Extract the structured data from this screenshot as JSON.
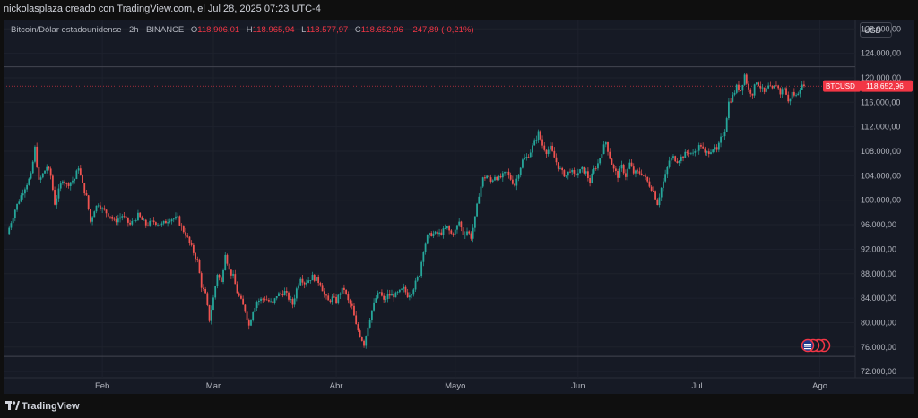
{
  "header": {
    "attribution": "nickolasplaza creado con TradingView.com, el Jul 28, 2025 07:23 UTC-4"
  },
  "legend": {
    "symbol": "Bitcoin/Dólar estadounidense · 2h · BINANCE",
    "open_label": "O",
    "open": "118.906,01",
    "high_label": "H",
    "high": "118.965,94",
    "low_label": "L",
    "low": "118.577,97",
    "close_label": "C",
    "close": "118.652,96",
    "change": "-247,89 (-0,21%)"
  },
  "currency_button": "USD",
  "price_tag": {
    "symbol": "BTCUSD",
    "price": "118.652,96"
  },
  "footer": {
    "brand": "TradingView"
  },
  "colors": {
    "up": "#26a69a",
    "down": "#ef5350",
    "background": "#161a25",
    "price_tag": "#f23645"
  },
  "chart_data": {
    "type": "candlestick",
    "title": "Bitcoin/Dólar estadounidense · 2h · BINANCE",
    "y_axis_position": "right",
    "ylim": [
      71000,
      129500
    ],
    "y_ticks": [
      {
        "value": 72000,
        "label": "72.000,00"
      },
      {
        "value": 76000,
        "label": "76.000,00"
      },
      {
        "value": 80000,
        "label": "80.000,00"
      },
      {
        "value": 84000,
        "label": "84.000,00"
      },
      {
        "value": 88000,
        "label": "88.000,00"
      },
      {
        "value": 92000,
        "label": "92.000,00"
      },
      {
        "value": 96000,
        "label": "96.000,00"
      },
      {
        "value": 100000,
        "label": "100.000,00"
      },
      {
        "value": 104000,
        "label": "104.000,00"
      },
      {
        "value": 108000,
        "label": "108.000,00"
      },
      {
        "value": 112000,
        "label": "112.000,00"
      },
      {
        "value": 116000,
        "label": "116.000,00"
      },
      {
        "value": 120000,
        "label": "120.000,00"
      },
      {
        "value": 124000,
        "label": "124.000,00"
      },
      {
        "value": 128000,
        "label": "128.000,00"
      }
    ],
    "x_ticks": [
      {
        "day": 31,
        "label": "Feb"
      },
      {
        "day": 59,
        "label": "Mar"
      },
      {
        "day": 90,
        "label": "Abr"
      },
      {
        "day": 120,
        "label": "Mayo"
      },
      {
        "day": 151,
        "label": "Jun"
      },
      {
        "day": 181,
        "label": "Jul"
      },
      {
        "day": 212,
        "label": "Ago"
      }
    ],
    "x_unit": "day of year 2025",
    "xlim": [
      7,
      220
    ],
    "horizontal_lines": [
      121800,
      74500
    ],
    "last_price": 118652.96,
    "close_path": [
      [
        7,
        94500
      ],
      [
        9,
        98500
      ],
      [
        11,
        101500
      ],
      [
        13,
        104000
      ],
      [
        14,
        108500
      ],
      [
        15,
        103000
      ],
      [
        17,
        105500
      ],
      [
        18,
        104000
      ],
      [
        19,
        99500
      ],
      [
        20,
        101500
      ],
      [
        21,
        103500
      ],
      [
        22,
        102500
      ],
      [
        24,
        103500
      ],
      [
        25,
        105500
      ],
      [
        26,
        102500
      ],
      [
        27,
        100500
      ],
      [
        28,
        96500
      ],
      [
        29,
        98500
      ],
      [
        30,
        99500
      ],
      [
        31,
        98500
      ],
      [
        33,
        97500
      ],
      [
        34,
        96500
      ],
      [
        36,
        97500
      ],
      [
        38,
        96000
      ],
      [
        40,
        97500
      ],
      [
        42,
        96000
      ],
      [
        44,
        96500
      ],
      [
        46,
        96000
      ],
      [
        48,
        97000
      ],
      [
        50,
        97000
      ],
      [
        51,
        95500
      ],
      [
        52,
        94500
      ],
      [
        53,
        93000
      ],
      [
        55,
        90000
      ],
      [
        56,
        86000
      ],
      [
        57,
        84500
      ],
      [
        58,
        80500
      ],
      [
        59,
        84000
      ],
      [
        60,
        88000
      ],
      [
        61,
        86500
      ],
      [
        62,
        91500
      ],
      [
        63,
        88500
      ],
      [
        64,
        87500
      ],
      [
        65,
        85000
      ],
      [
        66,
        83500
      ],
      [
        67,
        82000
      ],
      [
        68,
        79500
      ],
      [
        69,
        82000
      ],
      [
        70,
        83500
      ],
      [
        72,
        84000
      ],
      [
        74,
        83000
      ],
      [
        75,
        84500
      ],
      [
        77,
        85000
      ],
      [
        78,
        84000
      ],
      [
        79,
        83000
      ],
      [
        80,
        85500
      ],
      [
        81,
        87500
      ],
      [
        82,
        86500
      ],
      [
        84,
        87500
      ],
      [
        86,
        86500
      ],
      [
        87,
        84500
      ],
      [
        88,
        83500
      ],
      [
        89,
        84000
      ],
      [
        90,
        83500
      ],
      [
        91,
        85000
      ],
      [
        92,
        85500
      ],
      [
        93,
        83500
      ],
      [
        94,
        82500
      ],
      [
        95,
        79500
      ],
      [
        96,
        78000
      ],
      [
        97,
        76500
      ],
      [
        98,
        79500
      ],
      [
        99,
        82000
      ],
      [
        100,
        84000
      ],
      [
        101,
        85000
      ],
      [
        102,
        83500
      ],
      [
        103,
        84500
      ],
      [
        105,
        84500
      ],
      [
        106,
        85000
      ],
      [
        107,
        85500
      ],
      [
        108,
        84500
      ],
      [
        109,
        85000
      ],
      [
        110,
        86500
      ],
      [
        111,
        88000
      ],
      [
        112,
        92000
      ],
      [
        113,
        94000
      ],
      [
        114,
        94500
      ],
      [
        116,
        94500
      ],
      [
        117,
        95000
      ],
      [
        118,
        95500
      ],
      [
        119,
        94500
      ],
      [
        120,
        95000
      ],
      [
        121,
        96500
      ],
      [
        122,
        94500
      ],
      [
        123,
        95000
      ],
      [
        124,
        94000
      ],
      [
        125,
        97000
      ],
      [
        126,
        101000
      ],
      [
        127,
        103500
      ],
      [
        128,
        104000
      ],
      [
        129,
        103000
      ],
      [
        130,
        104000
      ],
      [
        131,
        103500
      ],
      [
        133,
        104500
      ],
      [
        134,
        103500
      ],
      [
        135,
        102500
      ],
      [
        136,
        104500
      ],
      [
        137,
        106500
      ],
      [
        138,
        107000
      ],
      [
        139,
        108000
      ],
      [
        140,
        109500
      ],
      [
        141,
        111000
      ],
      [
        142,
        109000
      ],
      [
        143,
        108000
      ],
      [
        144,
        108500
      ],
      [
        145,
        107000
      ],
      [
        146,
        105500
      ],
      [
        147,
        104500
      ],
      [
        148,
        104000
      ],
      [
        149,
        105000
      ],
      [
        150,
        104000
      ],
      [
        151,
        104500
      ],
      [
        152,
        105000
      ],
      [
        153,
        104500
      ],
      [
        154,
        103000
      ],
      [
        155,
        105000
      ],
      [
        156,
        106000
      ],
      [
        157,
        108000
      ],
      [
        158,
        109500
      ],
      [
        159,
        107000
      ],
      [
        160,
        105000
      ],
      [
        161,
        104000
      ],
      [
        162,
        105500
      ],
      [
        163,
        104000
      ],
      [
        164,
        106000
      ],
      [
        165,
        104500
      ],
      [
        166,
        104500
      ],
      [
        167,
        104500
      ],
      [
        168,
        103500
      ],
      [
        169,
        102500
      ],
      [
        170,
        101500
      ],
      [
        171,
        99500
      ],
      [
        172,
        102000
      ],
      [
        173,
        104000
      ],
      [
        174,
        106500
      ],
      [
        175,
        107000
      ],
      [
        176,
        106500
      ],
      [
        177,
        107000
      ],
      [
        178,
        107500
      ],
      [
        179,
        108000
      ],
      [
        180,
        107500
      ],
      [
        181,
        108500
      ],
      [
        182,
        109000
      ],
      [
        183,
        107500
      ],
      [
        184,
        108000
      ],
      [
        185,
        108500
      ],
      [
        186,
        108000
      ],
      [
        187,
        110000
      ],
      [
        188,
        111500
      ],
      [
        189,
        116000
      ],
      [
        190,
        117000
      ],
      [
        191,
        118500
      ],
      [
        192,
        118000
      ],
      [
        193,
        120500
      ],
      [
        194,
        118000
      ],
      [
        195,
        117500
      ],
      [
        196,
        119500
      ],
      [
        197,
        118500
      ],
      [
        198,
        117500
      ],
      [
        199,
        118500
      ],
      [
        200,
        118000
      ],
      [
        201,
        119000
      ],
      [
        202,
        117500
      ],
      [
        203,
        118500
      ],
      [
        204,
        116000
      ],
      [
        205,
        117500
      ],
      [
        206,
        117000
      ],
      [
        207,
        118500
      ],
      [
        208,
        118652.96
      ]
    ]
  }
}
